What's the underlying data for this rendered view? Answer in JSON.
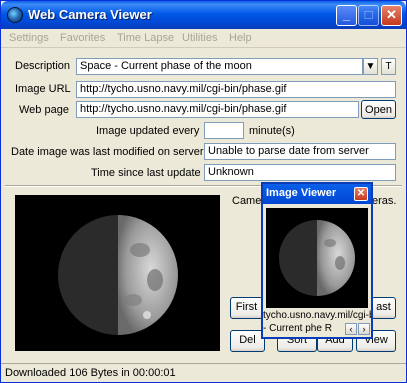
{
  "window": {
    "title": "Web Camera Viewer",
    "controls": {
      "minimize": "_",
      "maximize": "□",
      "close": "✕"
    }
  },
  "menu": [
    {
      "label": "Settings"
    },
    {
      "label": "Favorites"
    },
    {
      "label": "Time Lapse"
    },
    {
      "label": "Utilities"
    },
    {
      "label": "Help"
    }
  ],
  "form": {
    "description_label": "Description",
    "description_value": "Space - Current phase of the moon",
    "dropdown_arrow": "▼",
    "t_button": "T",
    "image_url_label": "Image URL",
    "image_url_value": "http://tycho.usno.navy.mil/cgi-bin/phase.gif",
    "web_page_label": "Web page",
    "web_page_value": "http://tycho.usno.navy.mil/cgi-bin/phase.gif",
    "open_button": "Open",
    "updated_every_label": "Image updated every",
    "updated_every_value": "",
    "updated_every_unit": "minute(s)",
    "last_modified_label": "Date image was last modified on server",
    "last_modified_value": "Unable to parse date from server",
    "time_since_label": "Time since last update",
    "time_since_value": "Unknown"
  },
  "lower": {
    "cameras_text_left": "Came",
    "cameras_text_right": "eras.",
    "first_button": "First",
    "last_button": "ast",
    "del_button": "Del",
    "sort_button": "Sort",
    "add_button": "Add",
    "view_button": "View"
  },
  "popup": {
    "title": "Image Viewer",
    "close": "✕",
    "url_text": "tycho.usno.navy.mil/cgi-bin",
    "desc_text": "- Current phe R",
    "scroll_left": "‹",
    "scroll_right": "›"
  },
  "status": {
    "text": "Downloaded 106 Bytes in 00:00:01"
  },
  "colors": {
    "title_blue": "#0058E6",
    "window_bg": "#ECE9D8",
    "close_red": "#C53A1D"
  }
}
